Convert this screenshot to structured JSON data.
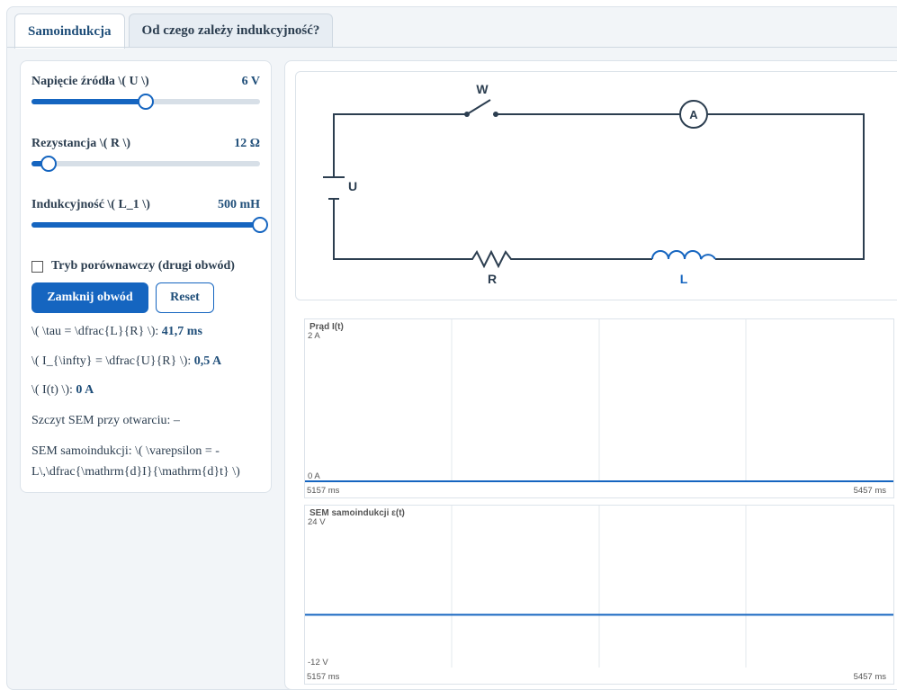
{
  "tabs": [
    {
      "label": "Samoindukcja",
      "active": true
    },
    {
      "label": "Od czego zależy indukcyjność?",
      "active": false
    }
  ],
  "controls": {
    "voltage": {
      "label": "Napięcie źródła \\( U \\)",
      "value_text": "6 V",
      "value": 6,
      "min": 0,
      "max": 12
    },
    "resistance": {
      "label": "Rezystancja \\( R \\)",
      "value_text": "12 Ω",
      "value": 12,
      "min": 5,
      "max": 100
    },
    "inductance": {
      "label": "Indukcyjność \\( L_1 \\)",
      "value_text": "500 mH",
      "value": 500,
      "min": 0,
      "max": 500
    },
    "compare_mode": {
      "label": "Tryb porównawczy (drugi obwód)",
      "checked": false
    },
    "close_button": "Zamknij obwód",
    "reset_button": "Reset"
  },
  "info": {
    "tau_label": "\\( \\tau = \\dfrac{L}{R} \\): ",
    "tau_value": "41,7 ms",
    "iinf_label": "\\( I_{\\infty} = \\dfrac{U}{R} \\): ",
    "iinf_value": "0,5 A",
    "it_label": "\\( I(t) \\): ",
    "it_value": "0 A",
    "peak_sem": "Szczyt SEM przy otwarciu: –",
    "sem_formula": "SEM samoindukcji: \\( \\varepsilon = -L\\,\\dfrac{\\mathrm{d}I}{\\mathrm{d}t} \\)"
  },
  "circuit": {
    "switch_label": "W",
    "ammeter_label": "A",
    "source_label": "U",
    "resistor_label": "R",
    "inductor_label": "L",
    "wire_color": "#2c3e50",
    "inductor_color": "#1565c0"
  },
  "chart_data": [
    {
      "type": "line",
      "title": "Prąd I(t)",
      "ymax_label": "2 A",
      "ymin_label": "0 A",
      "ylim": [
        0,
        2
      ],
      "x_start_label": "5157 ms",
      "x_end_label": "5457 ms",
      "xlim": [
        5157,
        5457
      ],
      "series": [
        {
          "x": [
            5157,
            5457
          ],
          "values": [
            0,
            0
          ]
        }
      ],
      "color": "#1565c0"
    },
    {
      "type": "line",
      "title": "SEM samoindukcji ε(t)",
      "ymax_label": "24 V",
      "ymin_label": "-12 V",
      "ylim": [
        -12,
        24
      ],
      "x_start_label": "5157 ms",
      "x_end_label": "5457 ms",
      "xlim": [
        5157,
        5457
      ],
      "series": [
        {
          "x": [
            5157,
            5457
          ],
          "values": [
            0,
            0
          ]
        }
      ],
      "color": "#1565c0"
    }
  ]
}
